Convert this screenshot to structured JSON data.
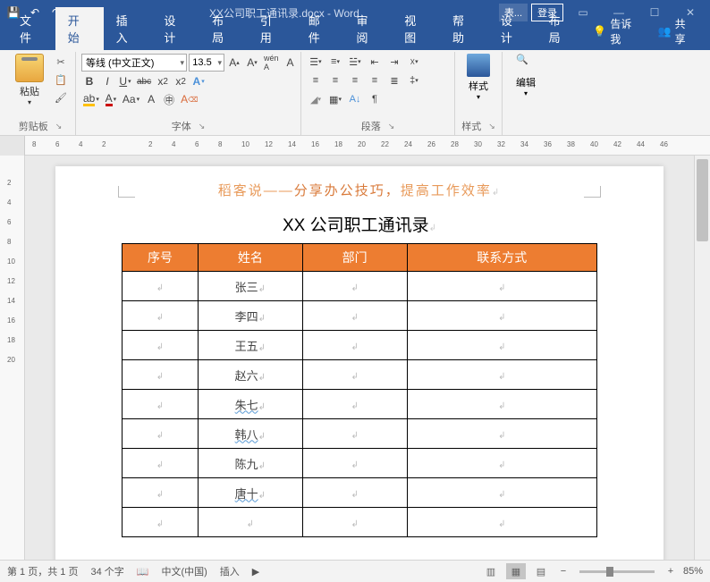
{
  "titlebar": {
    "doc_title": "XX公司职工通讯录.docx - Word",
    "tools_label": "表...",
    "login": "登录"
  },
  "tabs": {
    "file": "文件",
    "home": "开始",
    "insert": "插入",
    "design": "设计",
    "layout": "布局",
    "references": "引用",
    "mailings": "邮件",
    "review": "审阅",
    "view": "视图",
    "help": "帮助",
    "table_design": "设计",
    "table_layout": "布局",
    "tell_me": "告诉我",
    "share": "共享"
  },
  "ribbon": {
    "clipboard": {
      "paste": "粘贴",
      "label": "剪贴板"
    },
    "font": {
      "name": "等线 (中文正文)",
      "size": "13.5",
      "label": "字体"
    },
    "paragraph": {
      "label": "段落"
    },
    "styles": {
      "btn": "样式",
      "label": "样式"
    },
    "editing": {
      "btn": "编辑"
    }
  },
  "ruler_h": [
    "8",
    "6",
    "4",
    "2",
    "",
    "2",
    "4",
    "6",
    "8",
    "10",
    "12",
    "14",
    "16",
    "18",
    "20",
    "22",
    "24",
    "26",
    "28",
    "30",
    "32",
    "34",
    "36",
    "38",
    "40",
    "42",
    "44",
    "46"
  ],
  "ruler_v": [
    "",
    "2",
    "4",
    "6",
    "8",
    "10",
    "12",
    "14",
    "16",
    "18",
    "20"
  ],
  "document": {
    "watermark1": "稻客说——",
    "watermark2": "分享办公技巧，",
    "watermark3": "提高工作效率",
    "title": "XX 公司职工通讯录",
    "headers": [
      "序号",
      "姓名",
      "部门",
      "联系方式"
    ],
    "rows": [
      {
        "name": "张三",
        "wavy": false
      },
      {
        "name": "李四",
        "wavy": false
      },
      {
        "name": "王五",
        "wavy": false
      },
      {
        "name": "赵六",
        "wavy": false
      },
      {
        "name": "朱七",
        "wavy": true
      },
      {
        "name": "韩八",
        "wavy": true
      },
      {
        "name": "陈九",
        "wavy": false
      },
      {
        "name": "唐十",
        "wavy": true
      },
      {
        "name": "",
        "wavy": false
      }
    ]
  },
  "statusbar": {
    "page": "第 1 页，共 1 页",
    "words": "34 个字",
    "lang": "中文(中国)",
    "mode": "插入",
    "zoom": "85%"
  }
}
